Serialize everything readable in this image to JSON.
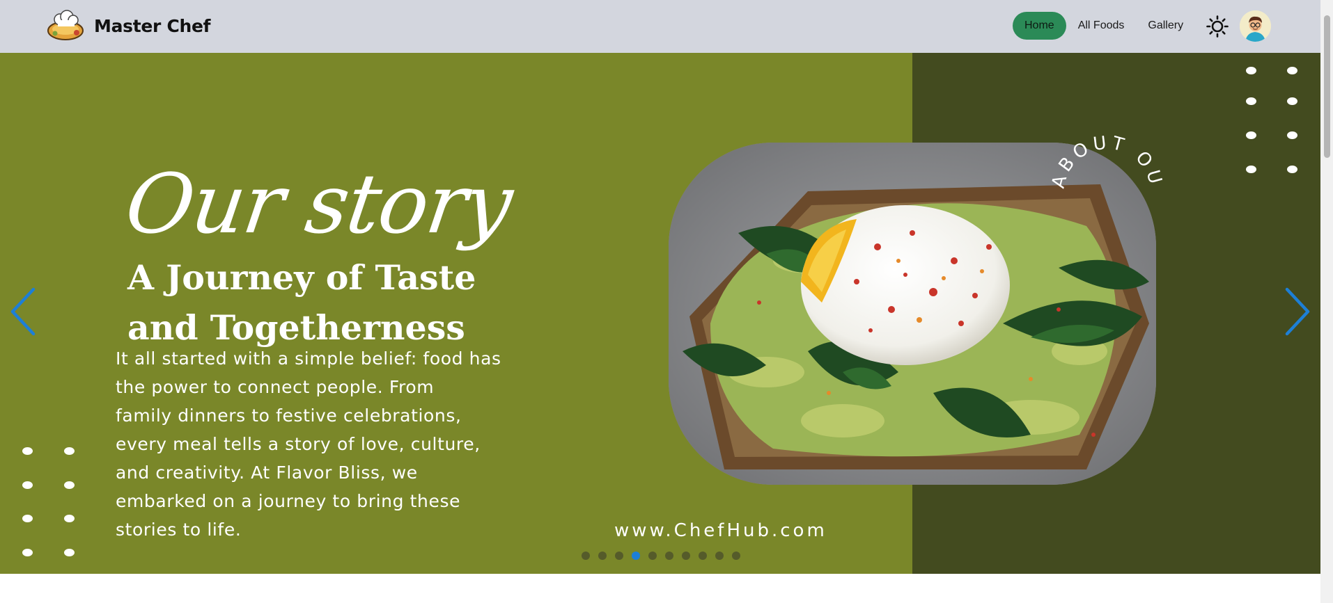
{
  "navbar": {
    "brand_name": "Master Chef",
    "links": [
      {
        "label": "Home",
        "active": true
      },
      {
        "label": "All Foods",
        "active": false
      },
      {
        "label": "Gallery",
        "active": false
      }
    ],
    "theme_icon": "sun-icon",
    "avatar_icon": "user-avatar"
  },
  "hero": {
    "script_title": "Our story",
    "headline_line1": "A Journey of Taste",
    "headline_line2": "and Togetherness",
    "story_lines": [
      "It all started with a simple belief: food has",
      "the power to connect people. From",
      "family dinners to festive celebrations,",
      "every meal tells a story of love, culture,",
      "and creativity. At Flavor Bliss, we",
      "embarked on a journey to bring these",
      "stories to life."
    ],
    "circle_text": "ABOUT OUR STORY",
    "website": "www.ChefHub.com",
    "image_alt": "poached-egg-avocado-toast",
    "prev_icon": "chevron-left-icon",
    "next_icon": "chevron-right-icon"
  },
  "slider": {
    "total_slides": 10,
    "active_slide": 4
  },
  "colors": {
    "nav_bg": "#d3d6de",
    "active_link": "#2b8a57",
    "hero_green": "#7a8729",
    "hero_dark": "#434b1f",
    "arrow_blue": "#1d7fd6"
  }
}
